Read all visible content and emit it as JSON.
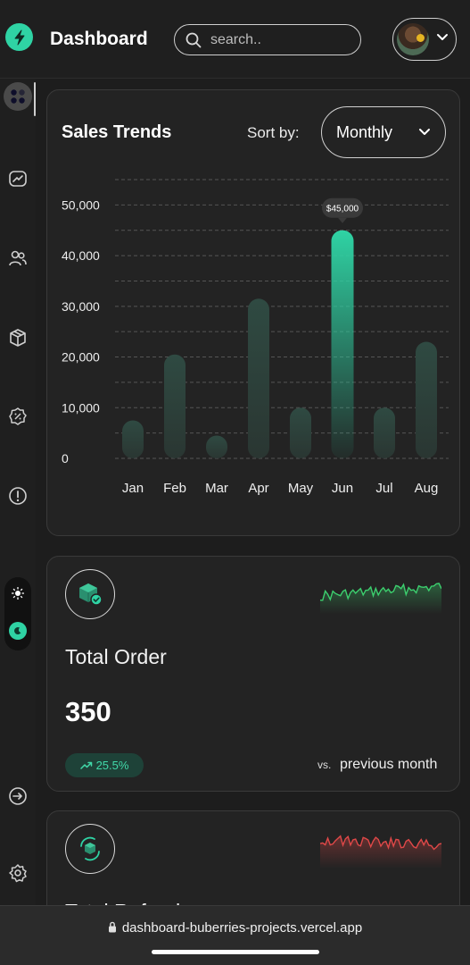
{
  "header": {
    "title": "Dashboard",
    "search_placeholder": "search..",
    "logo_icon": "bolt-icon",
    "profile_icon": "chevron-down-icon"
  },
  "sidebar": {
    "items": [
      {
        "icon": "dashboard-icon",
        "active": true
      },
      {
        "icon": "trend-chart-icon"
      },
      {
        "icon": "users-icon"
      },
      {
        "icon": "box-icon"
      },
      {
        "icon": "discount-badge-icon"
      },
      {
        "icon": "alert-icon"
      },
      {
        "icon": "logout-icon"
      },
      {
        "icon": "gear-icon"
      }
    ],
    "theme_toggle": {
      "light_icon": "sun-icon",
      "dark_icon": "moon-icon",
      "selected": "dark"
    }
  },
  "sales": {
    "title": "Sales Trends",
    "sort_label": "Sort by:",
    "sort_value": "Monthly"
  },
  "chart_data": {
    "type": "bar",
    "categories": [
      "Jan",
      "Feb",
      "Mar",
      "Apr",
      "May",
      "Jun",
      "Jul",
      "Aug"
    ],
    "values": [
      7500,
      20500,
      4500,
      31500,
      10000,
      45000,
      10000,
      23000
    ],
    "highlight_index": 5,
    "highlight_label": "$45,000",
    "y_ticks": [
      "0",
      "10,000",
      "20,000",
      "30,000",
      "40,000",
      "50,000"
    ],
    "ylim": [
      0,
      55000
    ],
    "grid": true,
    "accent": "#2fd3a4"
  },
  "total_order": {
    "icon": "package-check-icon",
    "title": "Total Order",
    "value": "350",
    "growth": "25.5%",
    "growth_icon": "trend-up-icon",
    "vs": "vs.",
    "comparison": "previous month",
    "sparkline_color": "#3ccf6e"
  },
  "total_refund": {
    "icon": "package-refund-icon",
    "title": "Total Refund",
    "sparkline_color": "#e04848"
  },
  "browser": {
    "url": "dashboard-buberries-projects.vercel.app"
  }
}
